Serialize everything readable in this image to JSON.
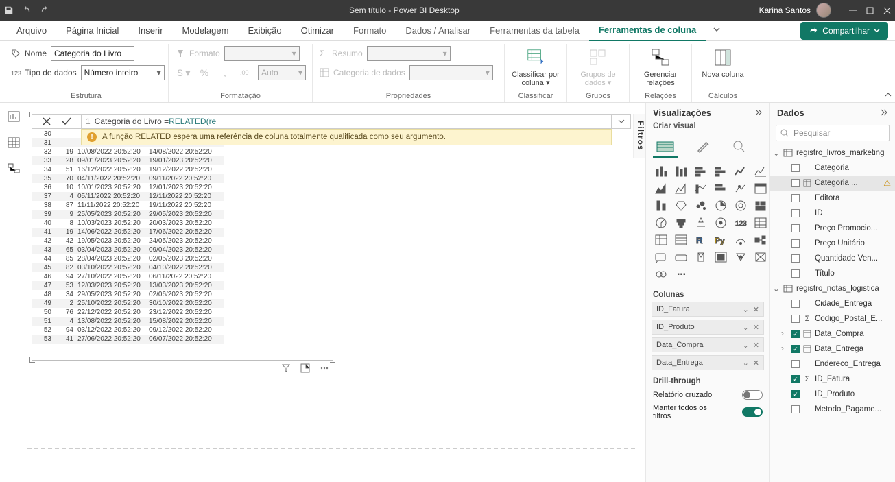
{
  "titlebar": {
    "title": "Sem título - Power BI Desktop",
    "user": "Karina Santos"
  },
  "tabs": {
    "file": "Arquivo",
    "home": "Página Inicial",
    "insert": "Inserir",
    "model": "Modelagem",
    "view": "Exibição",
    "optimize": "Otimizar",
    "format": "Formato",
    "data": "Dados / Analisar",
    "table_tools": "Ferramentas da tabela",
    "column_tools": "Ferramentas de coluna",
    "share": "Compartilhar"
  },
  "ribbon": {
    "structure": {
      "name_label": "Nome",
      "name_value": "Categoria do Livro",
      "type_label": "Tipo de dados",
      "type_value": "Número inteiro",
      "group": "Estrutura"
    },
    "format": {
      "format_label": "Formato",
      "auto": "Auto",
      "group": "Formatação"
    },
    "props": {
      "summary_label": "Resumo",
      "category_label": "Categoria de dados",
      "group": "Propriedades"
    },
    "sort": {
      "label": "Classificar por coluna",
      "group": "Classificar"
    },
    "groups": {
      "label": "Grupos de dados",
      "group": "Grupos"
    },
    "relations": {
      "label": "Gerenciar relações",
      "group": "Relações"
    },
    "calc": {
      "label": "Nova coluna",
      "group": "Cálculos"
    }
  },
  "formula": {
    "line": "1",
    "text_pre": "Categoria do Livro = ",
    "fn": "RELATED",
    "arg": "re",
    "error": "A função RELATED espera uma referência de coluna totalmente qualificada como seu argumento."
  },
  "table_rows": [
    {
      "a": "30",
      "b": "",
      "d1": "",
      "d2": ""
    },
    {
      "a": "31",
      "b": "",
      "d1": "",
      "d2": ""
    },
    {
      "a": "32",
      "b": "19",
      "d1": "10/08/2022 20:52:20",
      "d2": "14/08/2022 20:52:20"
    },
    {
      "a": "33",
      "b": "28",
      "d1": "09/01/2023 20:52:20",
      "d2": "19/01/2023 20:52:20"
    },
    {
      "a": "34",
      "b": "51",
      "d1": "16/12/2022 20:52:20",
      "d2": "19/12/2022 20:52:20"
    },
    {
      "a": "35",
      "b": "70",
      "d1": "04/11/2022 20:52:20",
      "d2": "09/11/2022 20:52:20"
    },
    {
      "a": "36",
      "b": "10",
      "d1": "10/01/2023 20:52:20",
      "d2": "12/01/2023 20:52:20"
    },
    {
      "a": "37",
      "b": "4",
      "d1": "05/11/2022 20:52:20",
      "d2": "12/11/2022 20:52:20"
    },
    {
      "a": "38",
      "b": "87",
      "d1": "11/11/2022 20:52:20",
      "d2": "19/11/2022 20:52:20"
    },
    {
      "a": "39",
      "b": "9",
      "d1": "25/05/2023 20:52:20",
      "d2": "29/05/2023 20:52:20"
    },
    {
      "a": "40",
      "b": "8",
      "d1": "10/03/2023 20:52:20",
      "d2": "20/03/2023 20:52:20"
    },
    {
      "a": "41",
      "b": "19",
      "d1": "14/06/2022 20:52:20",
      "d2": "17/06/2022 20:52:20"
    },
    {
      "a": "42",
      "b": "42",
      "d1": "19/05/2023 20:52:20",
      "d2": "24/05/2023 20:52:20"
    },
    {
      "a": "43",
      "b": "65",
      "d1": "03/04/2023 20:52:20",
      "d2": "09/04/2023 20:52:20"
    },
    {
      "a": "44",
      "b": "85",
      "d1": "28/04/2023 20:52:20",
      "d2": "02/05/2023 20:52:20"
    },
    {
      "a": "45",
      "b": "82",
      "d1": "03/10/2022 20:52:20",
      "d2": "04/10/2022 20:52:20"
    },
    {
      "a": "46",
      "b": "94",
      "d1": "27/10/2022 20:52:20",
      "d2": "06/11/2022 20:52:20"
    },
    {
      "a": "47",
      "b": "53",
      "d1": "12/03/2023 20:52:20",
      "d2": "13/03/2023 20:52:20"
    },
    {
      "a": "48",
      "b": "34",
      "d1": "29/05/2023 20:52:20",
      "d2": "02/06/2023 20:52:20"
    },
    {
      "a": "49",
      "b": "2",
      "d1": "25/10/2022 20:52:20",
      "d2": "30/10/2022 20:52:20"
    },
    {
      "a": "50",
      "b": "76",
      "d1": "22/12/2022 20:52:20",
      "d2": "23/12/2022 20:52:20"
    },
    {
      "a": "51",
      "b": "4",
      "d1": "13/08/2022 20:52:20",
      "d2": "15/08/2022 20:52:20"
    },
    {
      "a": "52",
      "b": "94",
      "d1": "03/12/2022 20:52:20",
      "d2": "09/12/2022 20:52:20"
    },
    {
      "a": "53",
      "b": "41",
      "d1": "27/06/2022 20:52:20",
      "d2": "06/07/2022 20:52:20"
    }
  ],
  "filters_label": "Filtros",
  "viz": {
    "title": "Visualizações",
    "sub": "Criar visual",
    "columns_label": "Colunas",
    "wells": [
      "ID_Fatura",
      "ID_Produto",
      "Data_Compra",
      "Data_Entrega"
    ],
    "drill_label": "Drill-through",
    "cross": "Relatório cruzado",
    "keep": "Manter todos os filtros"
  },
  "data": {
    "title": "Dados",
    "search": "Pesquisar",
    "table1": "registro_livros_marketing",
    "t1_fields": [
      {
        "name": "Categoria",
        "checked": false
      },
      {
        "name": "Categoria ...",
        "checked": false,
        "warn": true,
        "selected": true,
        "fx": true
      },
      {
        "name": "Editora",
        "checked": false
      },
      {
        "name": "ID",
        "checked": false
      },
      {
        "name": "Preço Promocio...",
        "checked": false
      },
      {
        "name": "Preço Unitário",
        "checked": false
      },
      {
        "name": "Quantidade Ven...",
        "checked": false
      },
      {
        "name": "Título",
        "checked": false
      }
    ],
    "table2": "registro_notas_logistica",
    "t2_fields": [
      {
        "name": "Cidade_Entrega",
        "checked": false
      },
      {
        "name": "Codigo_Postal_E...",
        "checked": false,
        "sigma": true
      },
      {
        "name": "Data_Compra",
        "checked": true,
        "expand": true,
        "hier": true
      },
      {
        "name": "Data_Entrega",
        "checked": true,
        "expand": true,
        "hier": true
      },
      {
        "name": "Endereco_Entrega",
        "checked": false
      },
      {
        "name": "ID_Fatura",
        "checked": true,
        "sigma": true
      },
      {
        "name": "ID_Produto",
        "checked": true
      },
      {
        "name": "Metodo_Pagame...",
        "checked": false
      }
    ]
  }
}
